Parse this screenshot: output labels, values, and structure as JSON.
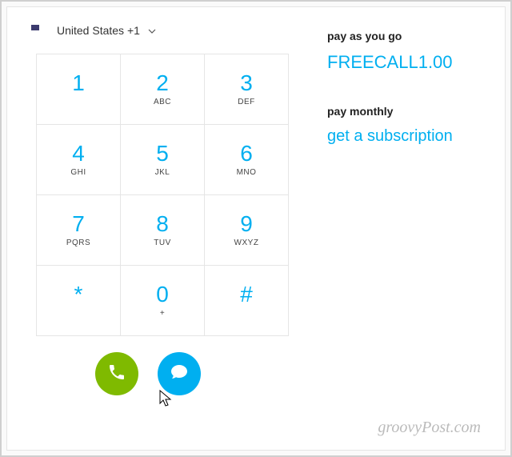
{
  "country": {
    "label": "United States +1"
  },
  "dialpad": [
    {
      "digit": "1",
      "letters": ""
    },
    {
      "digit": "2",
      "letters": "ABC"
    },
    {
      "digit": "3",
      "letters": "DEF"
    },
    {
      "digit": "4",
      "letters": "GHI"
    },
    {
      "digit": "5",
      "letters": "JKL"
    },
    {
      "digit": "6",
      "letters": "MNO"
    },
    {
      "digit": "7",
      "letters": "PQRS"
    },
    {
      "digit": "8",
      "letters": "TUV"
    },
    {
      "digit": "9",
      "letters": "WXYZ"
    },
    {
      "digit": "*",
      "letters": ""
    },
    {
      "digit": "0",
      "letters": "+"
    },
    {
      "digit": "#",
      "letters": ""
    }
  ],
  "sidebar": {
    "payg_label": "pay as you go",
    "payg_value": "FREECALL1.00",
    "monthly_label": "pay monthly",
    "subscription_link": "get a subscription"
  },
  "watermark": "groovyPost.com"
}
